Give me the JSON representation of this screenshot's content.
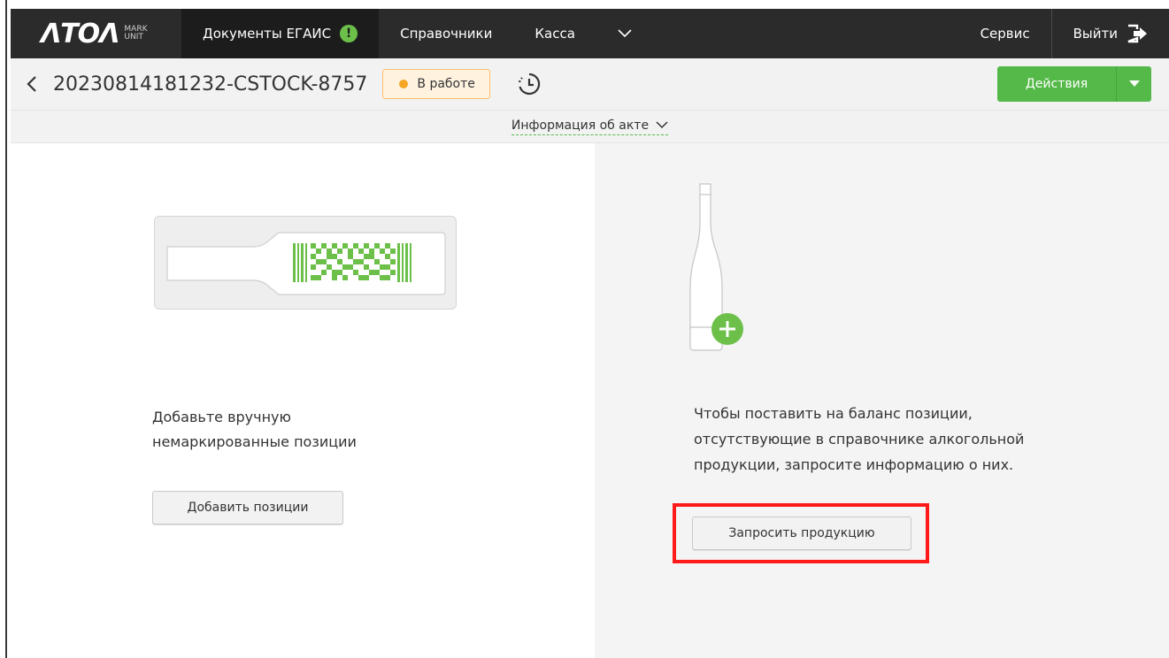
{
  "nav": {
    "logo_word": "ATOL",
    "logo_sub_1": "MARK",
    "logo_sub_2": "UNIT",
    "items": [
      {
        "label": "Документы ЕГАИС",
        "badge": "!"
      },
      {
        "label": "Справочники"
      },
      {
        "label": "Касса"
      }
    ],
    "service_label": "Сервис",
    "logout_label": "Выйти"
  },
  "header": {
    "doc_title": "20230814181232-CSTOCK-8757",
    "status_label": "В работе",
    "actions_label": "Действия"
  },
  "info_bar": {
    "label": "Информация об акте"
  },
  "left": {
    "text_line_1": "Добавьте вручную",
    "text_line_2": "немаркированные позиции",
    "button_label": "Добавить позиции"
  },
  "right": {
    "text_line_1": "Чтобы поставить на баланс позиции,",
    "text_line_2": "отсутствующие в справочнике алкогольной",
    "text_line_3": "продукции, запросите информацию о них.",
    "button_label": "Запросить продукцию"
  },
  "colors": {
    "accent_green": "#54b948",
    "nav_bg": "#2b2b2b",
    "status_bg": "#fff3e0",
    "status_dot": "#f6a623",
    "highlight": "#ff1a1a"
  }
}
